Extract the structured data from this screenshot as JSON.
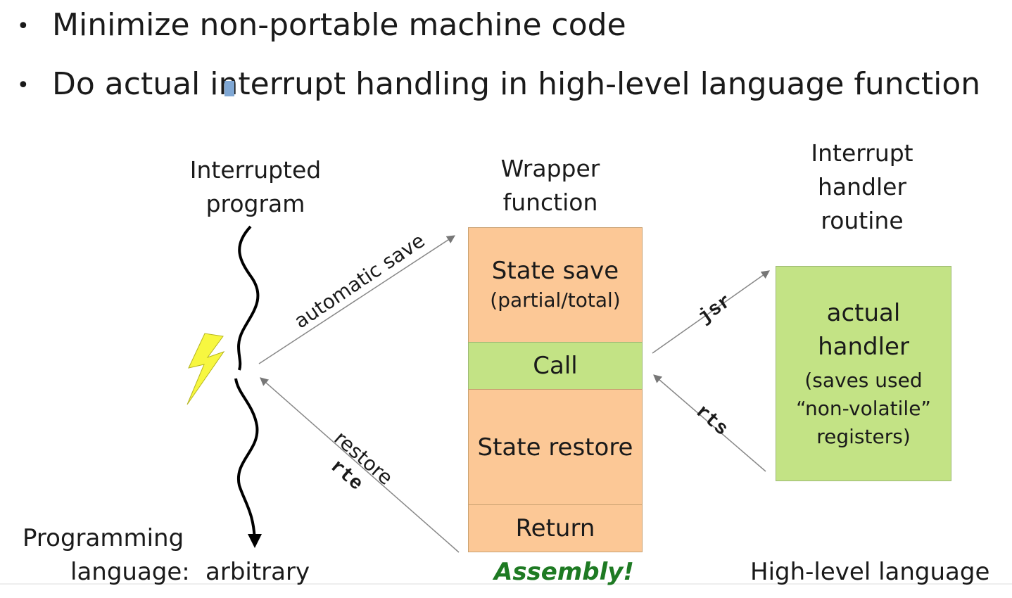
{
  "bullets": [
    {
      "bullet": "•",
      "text": "Minimize non-portable machine code"
    },
    {
      "bullet": "•",
      "text": "Do actual interrupt handling in high-level language function"
    }
  ],
  "columns": {
    "interrupted": {
      "line1": "Interrupted",
      "line2": "program"
    },
    "wrapper": {
      "line1": "Wrapper",
      "line2": "function"
    },
    "handler": {
      "line1": "Interrupt",
      "line2": "handler",
      "line3": "routine"
    }
  },
  "wrapper_blocks": {
    "state_save": {
      "title": "State save",
      "subtitle": "(partial/total)"
    },
    "call": "Call",
    "state_restore": "State restore",
    "return": "Return"
  },
  "handler_block": {
    "line1": "actual",
    "line2": "handler",
    "line3": "(saves used",
    "line4": "“non-volatile”",
    "line5": "registers)"
  },
  "arrows": {
    "automatic_save": "automatic save",
    "restore": "restore",
    "rte": "rte",
    "jsr": "jsr",
    "rts": "rts"
  },
  "bottom": {
    "prog_lang_1": "Programming",
    "prog_lang_2": "language:",
    "arbitrary": "arbitrary",
    "assembly": "Assembly!",
    "high_level": "High-level language"
  },
  "colors": {
    "orange_block": "#fcc896",
    "green_block": "#c3e385",
    "assembly_text": "#1e7a23",
    "lightning": "#f7f740"
  }
}
